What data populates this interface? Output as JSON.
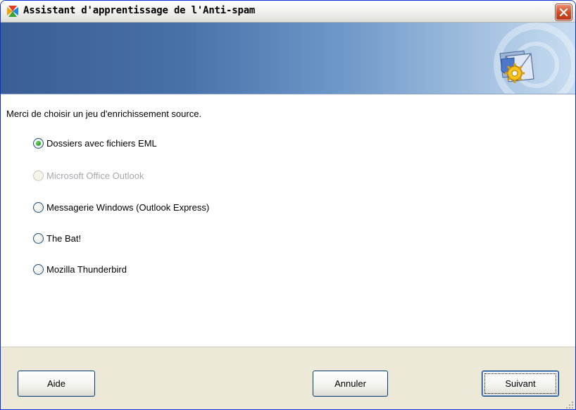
{
  "window": {
    "title": "Assistant d'apprentissage de l'Anti-spam"
  },
  "content": {
    "prompt": "Merci de choisir un jeu d'enrichissement source.",
    "options": [
      {
        "label": "Dossiers avec fichiers EML",
        "selected": true,
        "enabled": true
      },
      {
        "label": "Microsoft Office Outlook",
        "selected": false,
        "enabled": false
      },
      {
        "label": "Messagerie Windows (Outlook Express)",
        "selected": false,
        "enabled": true
      },
      {
        "label": "The Bat!",
        "selected": false,
        "enabled": true
      },
      {
        "label": "Mozilla Thunderbird",
        "selected": false,
        "enabled": true
      }
    ]
  },
  "footer": {
    "help_label": "Aide",
    "cancel_label": "Annuler",
    "next_label": "Suivant"
  },
  "colors": {
    "banner_dark": "#3a5e95",
    "banner_light": "#c7dcf0",
    "radio_selected": "#21a121",
    "close_button": "#d0491f"
  },
  "icons": [
    "app-logo-icon",
    "close-icon",
    "antispam-envelope-gear-icon",
    "size-grip-icon"
  ]
}
